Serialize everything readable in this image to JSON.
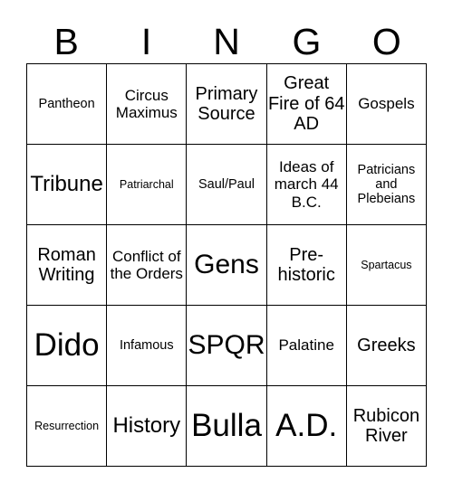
{
  "header": {
    "letters": [
      "B",
      "I",
      "N",
      "G",
      "O"
    ]
  },
  "colors": {
    "grid_line": "#000000",
    "cell_background": "#ffffff",
    "text": "#000000"
  },
  "grid": {
    "rows": 5,
    "columns": 5,
    "cells": [
      {
        "text": "Pantheon",
        "size": "fs-s"
      },
      {
        "text": "Circus Maximus",
        "size": "fs-m"
      },
      {
        "text": "Primary Source",
        "size": "fs-l"
      },
      {
        "text": "Great Fire of 64 AD",
        "size": "fs-l"
      },
      {
        "text": "Gospels",
        "size": "fs-m"
      },
      {
        "text": "Tribune",
        "size": "fs-xl"
      },
      {
        "text": "Patriarchal",
        "size": "fs-xs"
      },
      {
        "text": "Saul/Paul",
        "size": "fs-s"
      },
      {
        "text": "Ideas of march 44 B.C.",
        "size": "fs-m"
      },
      {
        "text": "Patricians and Plebeians",
        "size": "fs-s"
      },
      {
        "text": "Roman Writing",
        "size": "fs-l"
      },
      {
        "text": "Conflict of the Orders",
        "size": "fs-m"
      },
      {
        "text": "Gens",
        "size": "fs-xxl"
      },
      {
        "text": "Pre-historic",
        "size": "fs-l"
      },
      {
        "text": "Spartacus",
        "size": "fs-xs"
      },
      {
        "text": "Dido",
        "size": "fs-max"
      },
      {
        "text": "Infamous",
        "size": "fs-s"
      },
      {
        "text": "SPQR",
        "size": "fs-xxl"
      },
      {
        "text": "Palatine",
        "size": "fs-m"
      },
      {
        "text": "Greeks",
        "size": "fs-l"
      },
      {
        "text": "Resurrection",
        "size": "fs-xs"
      },
      {
        "text": "History",
        "size": "fs-xl"
      },
      {
        "text": "Bulla",
        "size": "fs-max"
      },
      {
        "text": "A.D.",
        "size": "fs-max"
      },
      {
        "text": "Rubicon River",
        "size": "fs-l"
      }
    ]
  }
}
